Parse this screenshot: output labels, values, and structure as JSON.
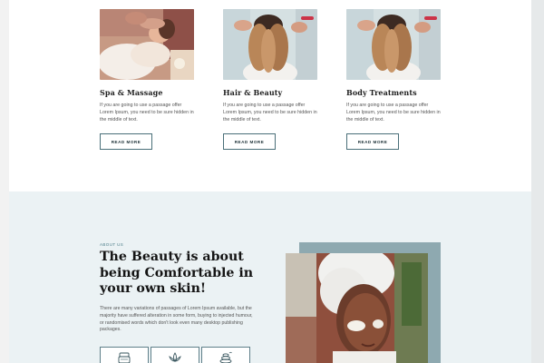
{
  "services": [
    {
      "title": "Spa & Massage",
      "description": "If you are going to use a passage offer Lorem Ipsum, you need to be sure hidden in the middle of text.",
      "button": "READ MORE"
    },
    {
      "title": "Hair & Beauty",
      "description": "If you are going to use a passage offer Lorem Ipsum, you need to be sure hidden in the middle of text.",
      "button": "READ MORE"
    },
    {
      "title": "Body Treatments",
      "description": "If you are going to use a passage offer Lorem Ipsum, you need to be sure hidden in the middle of text.",
      "button": "READ MORE"
    }
  ],
  "about": {
    "kicker": "ABOUT US",
    "heading": "The Beauty is about being Comfortable in your own skin!",
    "paragraph": "There are many variations of passages of Lorem Ipsum available, but the majority have suffered alteration in some form, buying to injected humour, or randomised words which don't look even many desktop publishing packages.",
    "features": [
      {
        "icon": "cream-jar-icon"
      },
      {
        "icon": "lotus-icon"
      },
      {
        "icon": "spa-stones-icon"
      }
    ]
  },
  "colors": {
    "accent": "#4a6f79",
    "section_bg": "#ebf2f4",
    "frame": "#8ea9b0"
  }
}
